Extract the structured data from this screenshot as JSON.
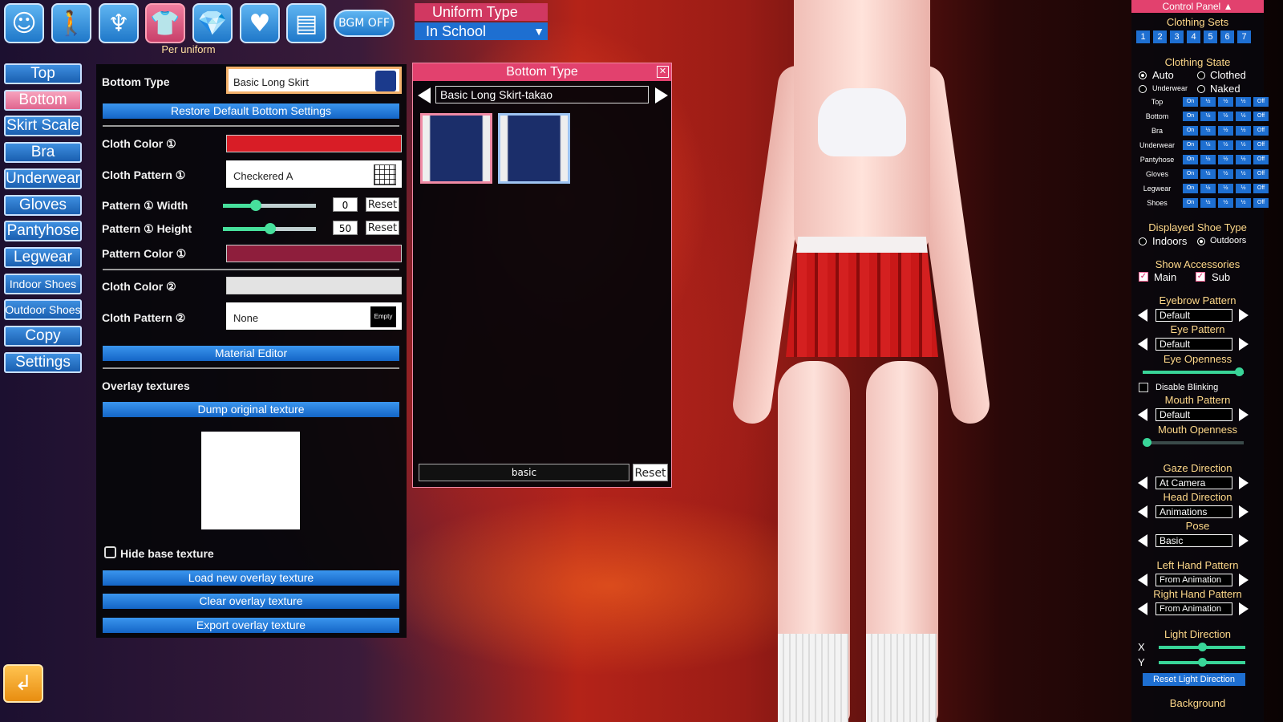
{
  "top_icons": [
    {
      "name": "face-icon",
      "glyph": "☺"
    },
    {
      "name": "body-icon",
      "glyph": "🚶"
    },
    {
      "name": "hair-icon",
      "glyph": "♆"
    },
    {
      "name": "clothing-icon",
      "glyph": "👕"
    },
    {
      "name": "accessory-icon",
      "glyph": "💎"
    },
    {
      "name": "heart-icon",
      "glyph": "♥"
    },
    {
      "name": "document-icon",
      "glyph": "▤"
    }
  ],
  "per_uniform": "Per uniform",
  "bgm_label": "BGM OFF",
  "sidebar": [
    {
      "label": "Top"
    },
    {
      "label": "Bottom"
    },
    {
      "label": "Skirt Scale"
    },
    {
      "label": "Bra"
    },
    {
      "label": "Underwear"
    },
    {
      "label": "Gloves"
    },
    {
      "label": "Pantyhose"
    },
    {
      "label": "Legwear"
    },
    {
      "label": "Indoor Shoes"
    },
    {
      "label": "Outdoor Shoes"
    },
    {
      "label": "Copy"
    },
    {
      "label": "Settings"
    }
  ],
  "back_icon": "return-arrow-icon",
  "editor": {
    "bottom_type_label": "Bottom Type",
    "bottom_type_value": "Basic Long Skirt",
    "restore_btn": "Restore Default Bottom Settings",
    "cloth_color1_label": "Cloth Color ①",
    "cloth_color1": "#d81d26",
    "cloth_pattern1_label": "Cloth Pattern ①",
    "cloth_pattern1_value": "Checkered A",
    "pattern_width_label": "Pattern ① Width",
    "pattern_width_value": "0",
    "pattern_height_label": "Pattern ① Height",
    "pattern_height_value": "50",
    "reset": "Reset",
    "pattern_color_label": "Pattern Color ①",
    "pattern_color": "#8e1e3c",
    "cloth_color2_label": "Cloth Color ②",
    "cloth_color2": "#e3e3e3",
    "cloth_pattern2_label": "Cloth Pattern ②",
    "cloth_pattern2_value": "None",
    "empty_label": "Empty",
    "material_editor": "Material Editor",
    "overlay_label": "Overlay textures",
    "dump_btn": "Dump original texture",
    "hide_base": "Hide base texture",
    "load_btn": "Load new overlay texture",
    "clear_btn": "Clear overlay texture",
    "export_btn": "Export overlay texture"
  },
  "uniform_type": {
    "title": "Uniform Type",
    "value": "In School"
  },
  "bottom_window": {
    "title": "Bottom Type",
    "current": "Basic Long Skirt-takao",
    "search": "basic",
    "reset": "Reset"
  },
  "right_panel": {
    "title": "Control Panel",
    "clothing_sets": "Clothing Sets",
    "sets": [
      "1",
      "2",
      "3",
      "4",
      "5",
      "6",
      "7"
    ],
    "clothing_state": "Clothing State",
    "auto": "Auto",
    "clothed": "Clothed",
    "underwear": "Underwear",
    "naked": "Naked",
    "rows": [
      "Top",
      "Bottom",
      "Bra",
      "Underwear",
      "Pantyhose",
      "Gloves",
      "Legwear",
      "Shoes"
    ],
    "on": "On",
    "half": "½",
    "off": "Off",
    "shoe_type": "Displayed Shoe Type",
    "indoors": "Indoors",
    "outdoors": "Outdoors",
    "show_acc": "Show Accessories",
    "main": "Main",
    "sub": "Sub",
    "eyebrow": "Eyebrow Pattern",
    "eyebrow_val": "Default",
    "eye": "Eye Pattern",
    "eye_val": "Default",
    "eye_open": "Eye Openness",
    "eye_open_value": 1.0,
    "disable_blink": "Disable Blinking",
    "mouth": "Mouth Pattern",
    "mouth_val": "Default",
    "mouth_open": "Mouth Openness",
    "mouth_open_value": 0.0,
    "gaze": "Gaze Direction",
    "gaze_val": "At Camera",
    "head": "Head Direction",
    "head_val": "Animations",
    "pose": "Pose",
    "pose_val": "Basic",
    "left_hand": "Left Hand Pattern",
    "left_hand_val": "From Animation",
    "right_hand": "Right Hand Pattern",
    "right_hand_val": "From Animation",
    "light": "Light Direction",
    "x": "X",
    "y": "Y",
    "light_x": 0.5,
    "light_y": 0.5,
    "reset_light": "Reset Light Direction",
    "background": "Background"
  },
  "colors": {
    "accent": "#1e6fd1",
    "selected": "#e2416e"
  }
}
